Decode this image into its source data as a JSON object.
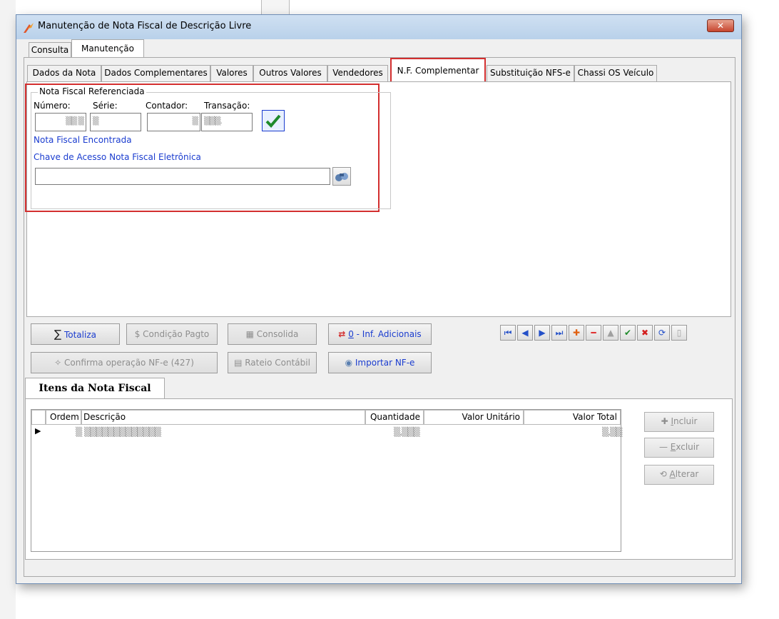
{
  "window": {
    "title": "Manutenção de Nota Fiscal de Descrição Livre",
    "close_label": "✕"
  },
  "top_tabs": [
    {
      "label": "Consulta"
    },
    {
      "label": "Manutenção"
    }
  ],
  "inner_tabs": [
    {
      "label": "Dados da Nota"
    },
    {
      "label": "Dados Complementares"
    },
    {
      "label": "Valores"
    },
    {
      "label": "Outros Valores"
    },
    {
      "label": "Vendedores"
    },
    {
      "label": "N.F. Complementar"
    },
    {
      "label": "Substituição NFS-e"
    },
    {
      "label": "Chassi OS Veículo"
    }
  ],
  "nf_ref": {
    "group_title": "Nota Fiscal Referenciada",
    "labels": {
      "numero": "Número:",
      "serie": "Série:",
      "contador": "Contador:",
      "transacao": "Transação:"
    },
    "values": {
      "numero": "▒▒ ▒",
      "serie": "▒",
      "contador": "▒",
      "transacao": "▒▒▒."
    },
    "found_text": "Nota Fiscal Encontrada",
    "chave_label": "Chave de Acesso Nota Fiscal Eletrônica",
    "chave_value": ""
  },
  "buttons": {
    "totaliza": "Totaliza",
    "condicao": "Condição Pagto",
    "consolida": "Consolida",
    "inf_prefix": "0",
    "inf_suffix": " - Inf. Adicionais",
    "confirma": "Confirma operação NF-e (427)",
    "rateio": "Rateio Contábil",
    "importar": "Importar NF-e"
  },
  "nav": [
    "first",
    "prev",
    "next",
    "last",
    "add",
    "delete",
    "up",
    "confirm",
    "cancel",
    "refresh",
    "bookmark"
  ],
  "items": {
    "tab_label": "Itens da Nota Fiscal",
    "columns": {
      "ordem": "Ordem",
      "descricao": "Descrição",
      "quantidade": "Quantidade",
      "valor_unitario": "Valor Unitário",
      "valor_total": "Valor Total"
    },
    "rows": [
      {
        "ordem": "▒",
        "descricao": "▒▒▒▒▒▒▒▒▒▒▒▒▒",
        "quantidade": "▒,▒▒▒",
        "valor_unitario": "",
        "valor_total": "▒,▒▒"
      }
    ],
    "actions": {
      "incluir_u": "I",
      "incluir_rest": "ncluir",
      "excluir_u": "E",
      "excluir_rest": "xcluir",
      "alterar_u": "A",
      "alterar_rest": "lterar"
    }
  },
  "colors": {
    "accent_red": "#d32f2f",
    "link_blue": "#1a3ccf"
  }
}
